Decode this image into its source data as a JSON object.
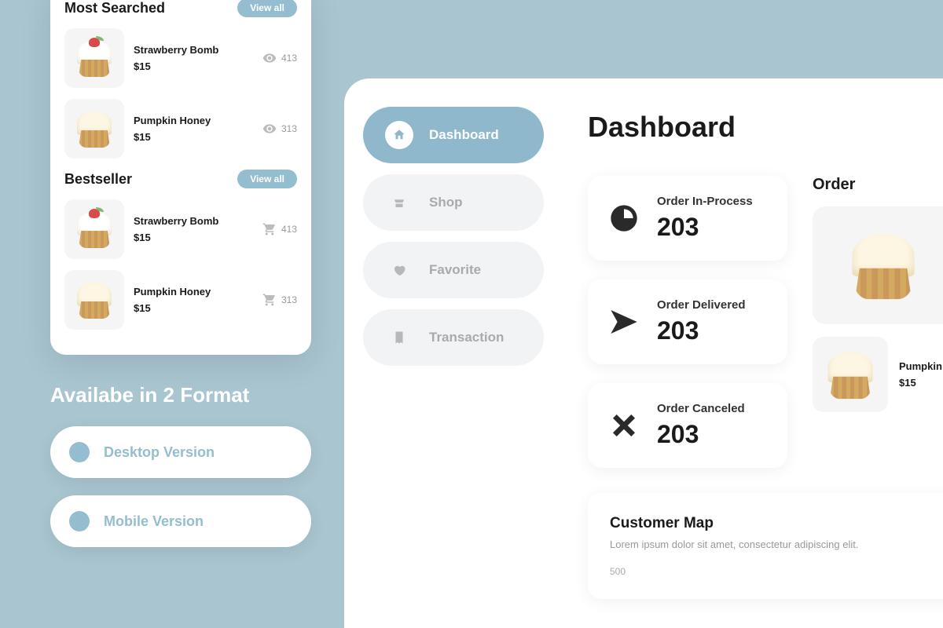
{
  "mobile": {
    "most_searched": {
      "title": "Most Searched",
      "view_all": "View all"
    },
    "bestseller": {
      "title": "Bestseller",
      "view_all": "View all"
    },
    "items": {
      "strawberry": {
        "name": "Strawberry Bomb",
        "price": "$15",
        "views": "413"
      },
      "pumpkin": {
        "name": "Pumpkin Honey",
        "price": "$15",
        "views": "313"
      },
      "strawberry2": {
        "name": "Strawberry Bomb",
        "price": "$15",
        "count": "413"
      },
      "pumpkin2": {
        "name": "Pumpkin Honey",
        "price": "$15",
        "count": "313"
      }
    }
  },
  "formats": {
    "title": "Availabe in 2 Format",
    "desktop": "Desktop Version",
    "mobile": "Mobile Version"
  },
  "sidebar": {
    "dashboard": "Dashboard",
    "shop": "Shop",
    "favorite": "Favorite",
    "transaction": "Transaction"
  },
  "page": {
    "title": "Dashboard"
  },
  "stats": {
    "in_process": {
      "label": "Order In-Process",
      "value": "203"
    },
    "delivered": {
      "label": "Order Delivered",
      "value": "203"
    },
    "canceled": {
      "label": "Order Canceled",
      "value": "203"
    }
  },
  "order": {
    "title": "Order",
    "item": {
      "name": "Pumpkin Honey",
      "price": "$15"
    }
  },
  "map": {
    "title": "Customer Map",
    "subtitle": "Lorem ipsum dolor sit amet, consectetur adipiscing elit.",
    "tick": "500"
  }
}
